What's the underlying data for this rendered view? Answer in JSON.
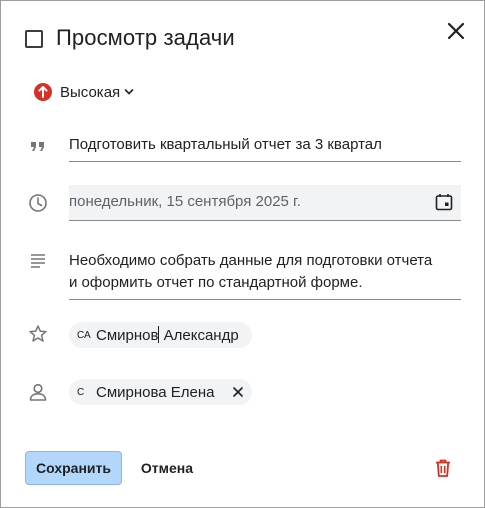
{
  "header": {
    "title": "Просмотр задачи"
  },
  "priority": {
    "label": "Высокая",
    "color": "#d93025"
  },
  "task": {
    "title": "Подготовить квартальный отчет за 3 квартал",
    "date": "понедельник, 15 сентября 2025 г.",
    "description_line1": "Необходимо собрать данные для подготовки отчета",
    "description_line2": "и оформить отчет по стандартной форме."
  },
  "assignee": {
    "initials": "СА",
    "name_part1": "Смирнов",
    "name_part2": " Александр"
  },
  "watcher": {
    "initials": "С",
    "name": "Смирнова Елена"
  },
  "footer": {
    "save_label": "Сохранить",
    "cancel_label": "Отмена"
  },
  "colors": {
    "accent": "#b3d7fb",
    "danger": "#d93025"
  }
}
